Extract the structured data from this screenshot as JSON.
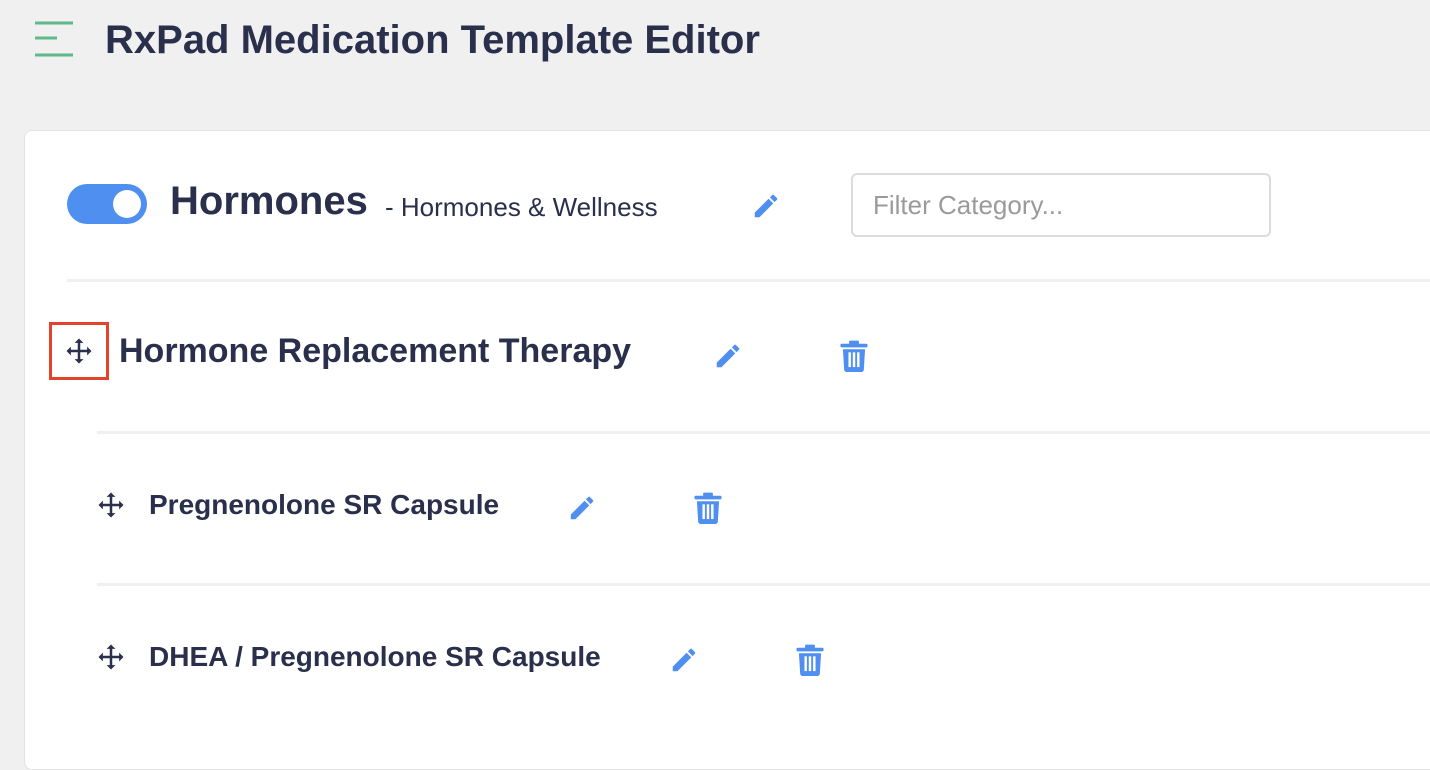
{
  "app": {
    "title": "RxPad Medication Template Editor"
  },
  "category": {
    "name": "Hormones",
    "subtitle": "- Hormones & Wellness",
    "enabled": true
  },
  "filter": {
    "placeholder": "Filter Category...",
    "value": ""
  },
  "group": {
    "title": "Hormone Replacement Therapy"
  },
  "items": [
    {
      "label": "Pregnenolone SR Capsule"
    },
    {
      "label": "DHEA / Pregnenolone SR Capsule"
    }
  ],
  "colors": {
    "accent": "#4f8ff0",
    "title": "#2a2f4c",
    "menu_icon": "#5fb98a",
    "highlight": "#e0452b"
  },
  "icons": {
    "menu": "hamburger-menu-icon",
    "edit": "pencil-icon",
    "delete": "trash-icon",
    "drag": "move-arrows-icon"
  }
}
